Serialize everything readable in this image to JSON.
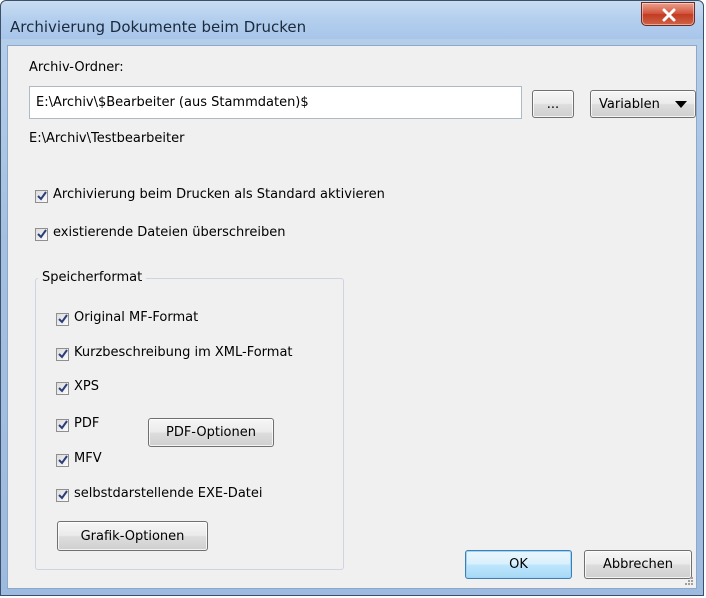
{
  "window": {
    "title": "Archivierung Dokumente beim Drucken",
    "close_glyph": "✕"
  },
  "folder": {
    "label": "Archiv-Ordner:",
    "value": "E:\\Archiv\\$Bearbeiter (aus Stammdaten)$",
    "browse_label": "...",
    "variables_label": "Variablen",
    "resolved_path": "E:\\Archiv\\Testbearbeiter"
  },
  "options": [
    {
      "label": "Archivierung beim Drucken als Standard aktivieren",
      "checked": true
    },
    {
      "label": "existierende Dateien überschreiben",
      "checked": true
    }
  ],
  "format_group": {
    "title": "Speicherformat",
    "items": [
      {
        "label": "Original MF-Format",
        "checked": true
      },
      {
        "label": "Kurzbeschreibung im XML-Format",
        "checked": true
      },
      {
        "label": "XPS",
        "checked": true
      },
      {
        "label": "PDF",
        "checked": true
      },
      {
        "label": "MFV",
        "checked": true
      },
      {
        "label": "selbstdarstellende EXE-Datei",
        "checked": true
      }
    ],
    "pdf_options_label": "PDF-Optionen",
    "graphic_options_label": "Grafik-Optionen"
  },
  "buttons": {
    "ok": "OK",
    "cancel": "Abbrechen"
  },
  "colors": {
    "titlebar": "#b4cfee",
    "close_button": "#c23b22",
    "client_bg": "#f0f0f0",
    "check_mark": "#2a3e7a"
  }
}
